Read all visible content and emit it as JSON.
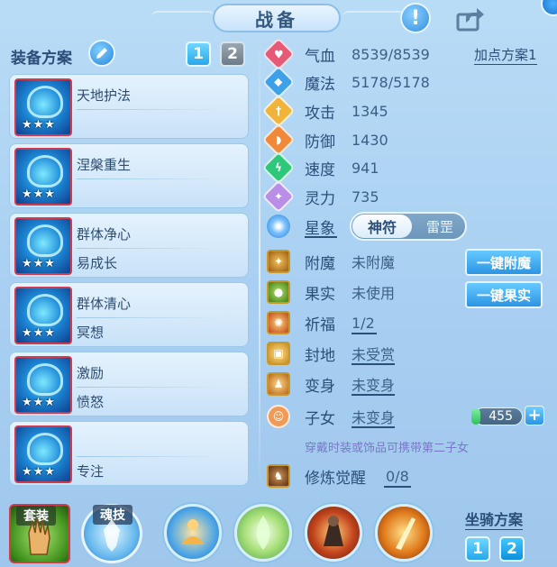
{
  "header": {
    "title": "战备"
  },
  "scheme": {
    "title": "装备方案",
    "pages": [
      "1",
      "2"
    ],
    "cards": [
      {
        "line1": "天地护法",
        "line2": "",
        "stars": "★★★"
      },
      {
        "line1": "涅槃重生",
        "line2": "",
        "stars": "★★★"
      },
      {
        "line1": "群体净心",
        "line2": "易成长",
        "stars": "★★★"
      },
      {
        "line1": "群体清心",
        "line2": "冥想",
        "stars": "★★★"
      },
      {
        "line1": "激励",
        "line2": "愤怒",
        "stars": "★★★"
      },
      {
        "line1": "",
        "line2": "专注",
        "stars": "★★★"
      }
    ]
  },
  "stats": {
    "plan_link": "加点方案1",
    "rows": [
      {
        "name": "气血",
        "value": "8539/8539",
        "color": "#e65a78",
        "icon": "heart-icon",
        "glyph": "♥"
      },
      {
        "name": "魔法",
        "value": "5178/5178",
        "color": "#3fa0ea",
        "icon": "mana-icon",
        "glyph": "◆"
      },
      {
        "name": "攻击",
        "value": "1345",
        "color": "#f0b43a",
        "icon": "sword-icon",
        "glyph": "†"
      },
      {
        "name": "防御",
        "value": "1430",
        "color": "#f08a3a",
        "icon": "shield-icon",
        "glyph": "◗"
      },
      {
        "name": "速度",
        "value": "941",
        "color": "#2fc77a",
        "icon": "speed-icon",
        "glyph": "ϟ"
      },
      {
        "name": "灵力",
        "value": "735",
        "color": "#b98ee6",
        "icon": "spirit-icon",
        "glyph": "✦"
      }
    ],
    "star": {
      "name": "星象",
      "toggle_on": "神符",
      "toggle_off": "雷罡"
    }
  },
  "extras": {
    "rows": [
      {
        "name": "附魔",
        "value": "未附魔"
      },
      {
        "name": "果实",
        "value": "未使用"
      },
      {
        "name": "祈福",
        "value": "1/2"
      },
      {
        "name": "封地",
        "value": "未受赏"
      },
      {
        "name": "变身",
        "value": "未变身"
      },
      {
        "name": "子女",
        "value": "未变身"
      },
      {
        "name": "修炼觉醒",
        "value": "0/8"
      }
    ],
    "btn_enchant": "一键附魔",
    "btn_fruit": "一键果实",
    "child_count": "455",
    "plus": "+",
    "hint": "穿戴时装或饰品可携带第二子女"
  },
  "bottom": {
    "set_label": "套装",
    "soul_label": "魂技",
    "mount_title": "坐骑方案",
    "mount_pages": [
      "1",
      "2"
    ]
  }
}
